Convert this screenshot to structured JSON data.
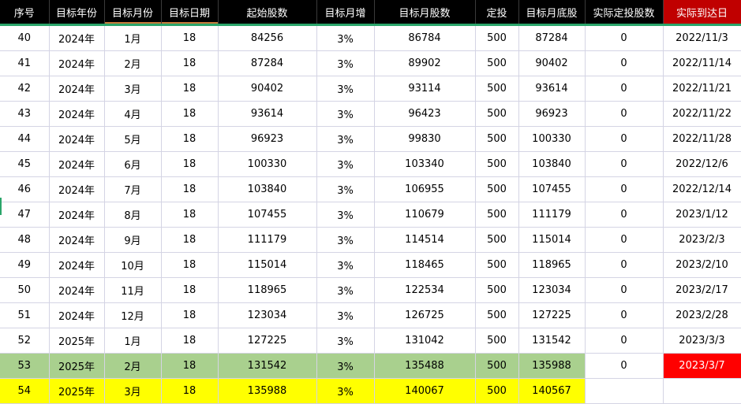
{
  "headers": [
    "序号",
    "目标年份",
    "目标月份",
    "目标日期",
    "起始股数",
    "目标月增",
    "目标月股数",
    "定投",
    "目标月底股",
    "实际定投股数",
    "实际到达日"
  ],
  "rows": [
    [
      "40",
      "2024年",
      "1月",
      "18",
      "84256",
      "3%",
      "86784",
      "500",
      "87284",
      "0",
      "2022/11/3"
    ],
    [
      "41",
      "2024年",
      "2月",
      "18",
      "87284",
      "3%",
      "89902",
      "500",
      "90402",
      "0",
      "2022/11/14"
    ],
    [
      "42",
      "2024年",
      "3月",
      "18",
      "90402",
      "3%",
      "93114",
      "500",
      "93614",
      "0",
      "2022/11/21"
    ],
    [
      "43",
      "2024年",
      "4月",
      "18",
      "93614",
      "3%",
      "96423",
      "500",
      "96923",
      "0",
      "2022/11/22"
    ],
    [
      "44",
      "2024年",
      "5月",
      "18",
      "96923",
      "3%",
      "99830",
      "500",
      "100330",
      "0",
      "2022/11/28"
    ],
    [
      "45",
      "2024年",
      "6月",
      "18",
      "100330",
      "3%",
      "103340",
      "500",
      "103840",
      "0",
      "2022/12/6"
    ],
    [
      "46",
      "2024年",
      "7月",
      "18",
      "103840",
      "3%",
      "106955",
      "500",
      "107455",
      "0",
      "2022/12/14"
    ],
    [
      "47",
      "2024年",
      "8月",
      "18",
      "107455",
      "3%",
      "110679",
      "500",
      "111179",
      "0",
      "2023/1/12"
    ],
    [
      "48",
      "2024年",
      "9月",
      "18",
      "111179",
      "3%",
      "114514",
      "500",
      "115014",
      "0",
      "2023/2/3"
    ],
    [
      "49",
      "2024年",
      "10月",
      "18",
      "115014",
      "3%",
      "118465",
      "500",
      "118965",
      "0",
      "2023/2/10"
    ],
    [
      "50",
      "2024年",
      "11月",
      "18",
      "118965",
      "3%",
      "122534",
      "500",
      "123034",
      "0",
      "2023/2/17"
    ],
    [
      "51",
      "2024年",
      "12月",
      "18",
      "123034",
      "3%",
      "126725",
      "500",
      "127225",
      "0",
      "2023/2/28"
    ],
    [
      "52",
      "2025年",
      "1月",
      "18",
      "127225",
      "3%",
      "131042",
      "500",
      "131542",
      "0",
      "2023/3/3"
    ],
    [
      "53",
      "2025年",
      "2月",
      "18",
      "131542",
      "3%",
      "135488",
      "500",
      "135988",
      "0",
      "2023/3/7"
    ],
    [
      "54",
      "2025年",
      "3月",
      "18",
      "135988",
      "3%",
      "140067",
      "500",
      "140567",
      "",
      ""
    ]
  ],
  "colors": {
    "header_bg": "#000000",
    "header_highlight": "#c00000",
    "row_highlight_green": "#a9d08e",
    "row_highlight_yellow": "#ffff00",
    "cell_red": "#ff0000",
    "zero_text": "#e00000",
    "accent_line": "#2aa56a"
  }
}
